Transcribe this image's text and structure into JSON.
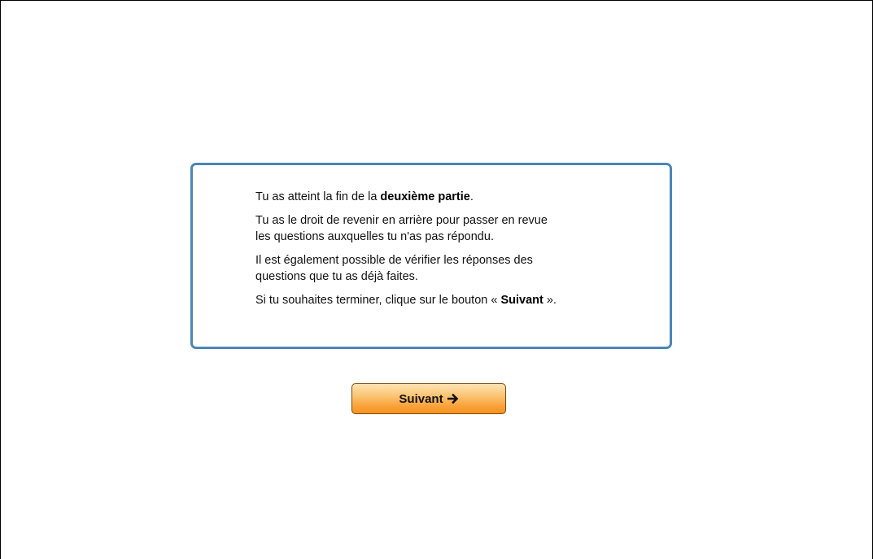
{
  "message": {
    "line1_prefix": "Tu as atteint la fin de la ",
    "line1_bold": "deuxième partie",
    "line1_suffix": ".",
    "para2_line1": "Tu as le droit de revenir en arrière pour passer en revue",
    "para2_line2": "les questions auxquelles tu n'as pas répondu.",
    "para3_line1": "Il est également possible de vérifier les réponses des",
    "para3_line2": "questions que tu as déjà faites.",
    "para4_prefix": "Si tu souhaites terminer, clique sur le bouton « ",
    "para4_bold": "Suivant",
    "para4_suffix": " »."
  },
  "next_button": {
    "label": "Suivant",
    "icon": "arrow-right-icon"
  },
  "colors": {
    "box_border": "#4a86b9",
    "button_gradient_top": "#fde4b4",
    "button_gradient_bottom": "#f7931e",
    "button_border": "#7a4a10"
  }
}
